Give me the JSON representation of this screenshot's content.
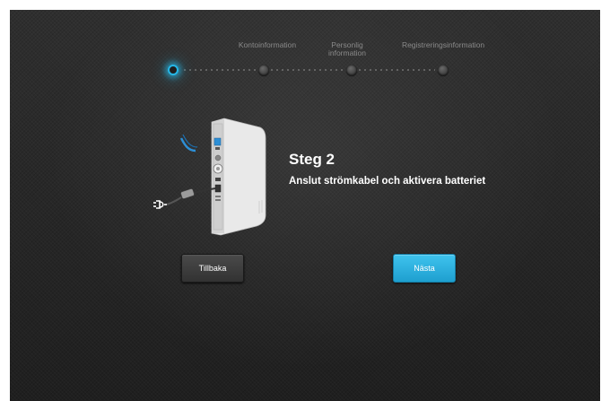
{
  "steps": [
    {
      "label": "",
      "state": "current"
    },
    {
      "label": "Kontoinformation",
      "state": "upcoming"
    },
    {
      "label": "Personlig information",
      "state": "upcoming"
    },
    {
      "label": "Registreringsinformation",
      "state": "upcoming"
    }
  ],
  "step_labels": {
    "account": "Kontoinformation",
    "personal_line1": "Personlig",
    "personal_line2": "information",
    "registration": "Registreringsinformation"
  },
  "content": {
    "title": "Steg 2",
    "description": "Anslut strömkabel och aktivera batteriet",
    "illustration_icon": "router-power-cable-icon"
  },
  "buttons": {
    "back_label": "Tillbaka",
    "next_label": "Nästa"
  },
  "colors": {
    "accent": "#26b6e6",
    "background": "#2c2c2c",
    "text": "#ffffff"
  }
}
